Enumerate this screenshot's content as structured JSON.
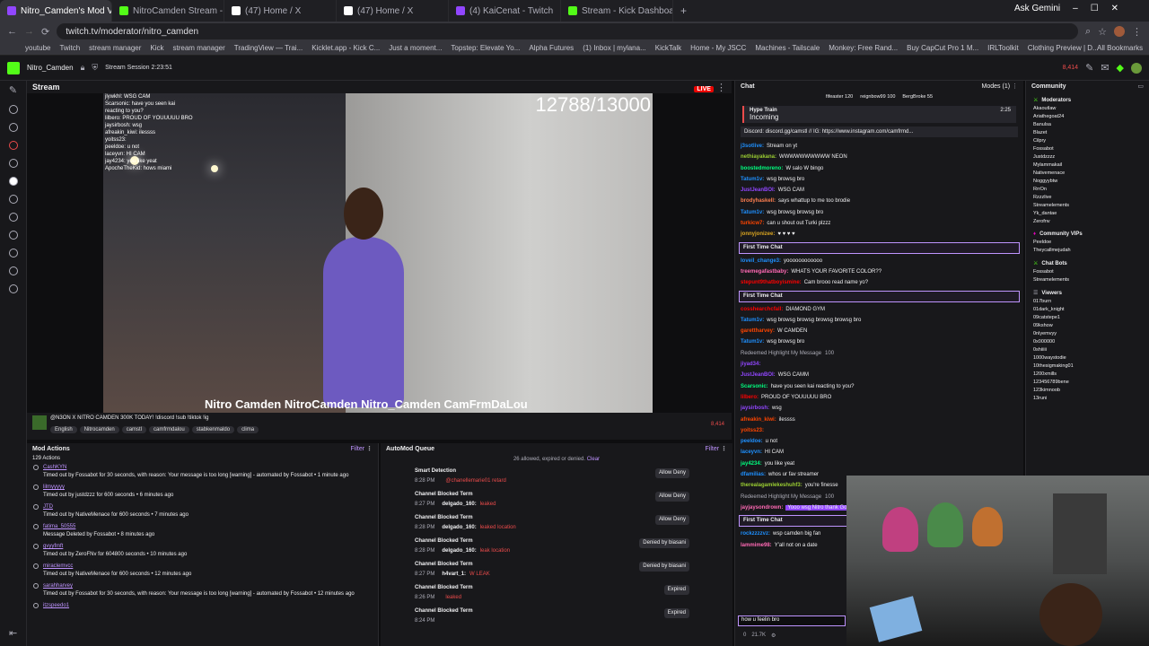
{
  "tabs": [
    {
      "label": "Nitro_Camden's Mod View",
      "active": true,
      "color": "#9146ff"
    },
    {
      "label": "NitroCamden Stream - Watch",
      "active": false,
      "color": "#53fc18"
    },
    {
      "label": "(47) Home / X",
      "active": false,
      "color": "#ffffff"
    },
    {
      "label": "(47) Home / X",
      "active": false,
      "color": "#ffffff"
    },
    {
      "label": "(4) KaiCenat - Twitch",
      "active": false,
      "color": "#9146ff"
    },
    {
      "label": "Stream - Kick Dashboard",
      "active": false,
      "color": "#53fc18"
    }
  ],
  "browser": {
    "ask_gemini": "Ask Gemini",
    "url": "twitch.tv/moderator/nitro_camden",
    "all_bookmarks": "All Bookmarks"
  },
  "bookmarks": [
    "youtube",
    "Twitch",
    "stream manager",
    "Kick",
    "stream manager",
    "TradingView — Trai...",
    "Kicklet.app - Kick C...",
    "Just a moment...",
    "Topstep: Elevate Yo...",
    "Alpha Futures",
    "(1) Inbox | mylana...",
    "KickTalk",
    "Home - My JSCC",
    "Machines - Tailscale",
    "Monkey: Free Rand...",
    "Buy CapCut Pro 1 M...",
    "IRLToolkit",
    "Clothing Preview | D..."
  ],
  "topnav": {
    "channel": "Nitro_Camden",
    "session": "Stream Session 2:23:51",
    "viewers": "8,414"
  },
  "stream": {
    "header": "Stream",
    "live": "LIVE",
    "counter": "12788/13000",
    "socials": "Nitro Camden  NitroCamden  Nitro_Camden  CamFrmDaLou",
    "overlay_chat": [
      "jlywkhl: WSG CAM",
      "Scarsonic: have you seen kai",
      "reacting to you?",
      "lilbero: PROUD OF YOUUUUU BRO",
      "jaysirbosh: wsg",
      "afreakin_kiwi: ilessss",
      "yoitss23:",
      "peeldoe: u not",
      "laceyvn: HI CAM",
      "jay4234: you like yeat",
      "ApocheTheKid: hows miami"
    ]
  },
  "stream_info": {
    "title": "@N3ON X NITRO CAMDEN 300K TODAY! !discord !sub !tiktok !ig",
    "viewers": "8,414",
    "tags": [
      "English",
      "Nitrocamden",
      "camstl",
      "camfrmdalou",
      "stabkenmaldo",
      "clima"
    ]
  },
  "mod_actions": {
    "title": "Mod Actions",
    "filter": "Filter",
    "count": "129 Actions",
    "items": [
      {
        "user": "CashKYN",
        "text": "Timed out by Fossabot for 30 seconds, with reason: Your message is too long [warning] - automated by Fossabot • 1 minute ago"
      },
      {
        "user": "lilmyyyyy",
        "text": "Timed out by justdzzz for 600 seconds • 6 minutes ago"
      },
      {
        "user": "JTD",
        "text": "Timed out by NativeMenace for 600 seconds • 7 minutes ago"
      },
      {
        "user": "fatima_50555",
        "text": "Message Deleted by Fossabot • 8 minutes ago"
      },
      {
        "user": "gvyyfmft",
        "text": "Timed out by ZeroFNv for 604800 seconds • 10 minutes ago"
      },
      {
        "user": "miraclemvcc",
        "text": "Timed out by NativeMenace for 600 seconds • 12 minutes ago"
      },
      {
        "user": "sarahharvey",
        "text": "Timed out by Fossabot for 30 seconds, with reason: Your message is too long [warning] - automated by Fossabot • 12 minutes ago"
      },
      {
        "user": "itzspeedo1",
        "text": ""
      }
    ]
  },
  "automod": {
    "title": "AutoMod Queue",
    "filter": "Filter",
    "summary": "26 allowed, expired or denied.",
    "clear": "Clear",
    "items": [
      {
        "type": "Smart Detection",
        "time": "8:28 PM",
        "user": "",
        "msg": "@chanellemarie01 retard",
        "state": "Allow  Deny"
      },
      {
        "type": "Channel Blocked Term",
        "time": "8:27 PM",
        "user": "delgado_160:",
        "msg": "leaked",
        "state": "Allow  Deny"
      },
      {
        "type": "Channel Blocked Term",
        "time": "8:28 PM",
        "user": "delgado_160:",
        "msg": "leaked location",
        "state": "Allow  Deny"
      },
      {
        "type": "Channel Blocked Term",
        "time": "8:28 PM",
        "user": "delgado_160:",
        "msg": "leak location",
        "state": "Denied by biasani"
      },
      {
        "type": "Channel Blocked Term",
        "time": "8:27 PM",
        "user": "h4vart_1:",
        "msg": "W LEAK",
        "state": "Denied by biasani"
      },
      {
        "type": "Channel Blocked Term",
        "time": "8:26 PM",
        "user": "",
        "msg": "leaked",
        "state": "Expired"
      },
      {
        "type": "Channel Blocked Term",
        "time": "8:24 PM",
        "user": "",
        "msg": "",
        "state": "Expired"
      }
    ]
  },
  "chat": {
    "title": "Chat",
    "modes": "Modes (1)",
    "gifters": [
      "fifeaster 120",
      "reignbow99 100",
      "BergBroke 55"
    ],
    "hype_title": "Hype Train",
    "hype_status": "Incoming",
    "hype_time": "2:25",
    "pinned": "Discord: discord.gg/camstl // IG: https://www.instagram.com/camfrmd...",
    "first_time": "First Time Chat",
    "redeemed": "Redeemed Highlight My Message",
    "redeem_cost": "100",
    "messages": [
      {
        "name": "j3sotlive:",
        "text": "Stream on yt",
        "color": "#1e90ff"
      },
      {
        "name": "nethiayakana:",
        "text": "WWWWWWWWWW NEON",
        "color": "#9acd32"
      },
      {
        "name": "boostedmoreno:",
        "text": "W salo W bingo",
        "color": "#00ff7f"
      },
      {
        "name": "Tatum1v:",
        "text": "wsg browsg bro",
        "color": "#1e90ff"
      },
      {
        "name": "JustJeanBOI:",
        "text": "WSG CAM",
        "color": "#9146ff"
      },
      {
        "name": "brodyhaskell:",
        "text": "says whattup to me too brodie",
        "color": "#ff7f50"
      },
      {
        "name": "Tatum1v:",
        "text": "wsg browsg browsg bro",
        "color": "#1e90ff"
      },
      {
        "name": "turkicw7:",
        "text": "can u shout out Turki plzzz",
        "color": "#ff4500"
      },
      {
        "name": "jonnyjonizee:",
        "text": "♥ ♥ ♥ ♥",
        "color": "#daa520"
      },
      {
        "name": "loveil_change3:",
        "text": "yoooooooooooo",
        "color": "#1e90ff"
      },
      {
        "name": "treemegafastbaby:",
        "text": "WHATS YOUR FAVORITE COLOR??",
        "color": "#ff69b4"
      },
      {
        "name": "stepunt9thatboyismine:",
        "text": "Cam brooo read name yo?",
        "color": "#ff0000"
      },
      {
        "name": "cosshearchcfall:",
        "text": "DIAMOND GYM",
        "color": "#ff0000"
      },
      {
        "name": "Tatum1v:",
        "text": "wsg browsg browsg browsg browsg bro",
        "color": "#1e90ff"
      },
      {
        "name": "garettharvey:",
        "text": "W CAMDEN",
        "color": "#ff4500"
      },
      {
        "name": "Tatum1v:",
        "text": "wsg browsg bro",
        "color": "#1e90ff"
      },
      {
        "name": "jiyad34:",
        "text": "",
        "color": "#9146ff"
      },
      {
        "name": "JustJeanBOI:",
        "text": "WSG CAMM",
        "color": "#9146ff"
      },
      {
        "name": "Scarsonic:",
        "text": "have you seen kai reacting to you?",
        "color": "#00ff7f"
      },
      {
        "name": "lilbero:",
        "text": "PROUD OF YOUUUUU BRO",
        "color": "#ff0000"
      },
      {
        "name": "jaysirbosh:",
        "text": "wsg",
        "color": "#9146ff"
      },
      {
        "name": "afreakin_kiwi:",
        "text": "ilessss",
        "color": "#ff4500"
      },
      {
        "name": "yoitss23:",
        "text": "",
        "color": "#ff4500"
      },
      {
        "name": "peeldoe:",
        "text": "u not",
        "color": "#1e90ff"
      },
      {
        "name": "laceyvn:",
        "text": "HI CAM",
        "color": "#1e90ff"
      },
      {
        "name": "jay4234:",
        "text": "you like yeat",
        "color": "#00ff7f"
      },
      {
        "name": "dfamilias:",
        "text": "whos ur fav streamer",
        "color": "#1e90ff"
      },
      {
        "name": "therealagamlekeshuhf3:",
        "text": "you're finesse",
        "color": "#9acd32"
      },
      {
        "name": "jayjaysondrown:",
        "text": "Yooo wsg Nitro thank God",
        "color": "#ff69b4"
      },
      {
        "name": "rockzzzzvz:",
        "text": "wsp camden big fan",
        "color": "#1e90ff"
      },
      {
        "name": "lammime98:",
        "text": "Y'all not on a date",
        "color": "#ff69b4"
      }
    ],
    "input": "how u feelin bro",
    "points": "21.7K",
    "zero": "0"
  },
  "community": {
    "title": "Community",
    "moderators_label": "Moderators",
    "moderators": [
      "Akaoutlaw",
      "Ariathegoat24",
      "Banulsa",
      "Blazet",
      "Cilpry",
      "Fossabot",
      "Justdzzzz",
      "Mylammakail",
      "Nativemenace",
      "Noggyybtw",
      "RrrOn",
      "Rzzzlive",
      "Streamelements",
      "Yk_dantae",
      "Zerofnv"
    ],
    "vips_label": "Community VIPs",
    "vips": [
      "Peeldoe",
      "Theycallmejudah"
    ],
    "bots_label": "Chat Bots",
    "bots": [
      "Fossabot",
      "Streamelements"
    ],
    "viewers_label": "Viewers",
    "viewers": [
      "017burn",
      "01dark_knight",
      "09catstepe1",
      "09kshow",
      "0nlyemvyy",
      "0x000000",
      "0shiiiii",
      "1000waystodie",
      "10thesigmaking01",
      "1200xmills",
      "123456789bene",
      "123kimnoob",
      "13runi"
    ]
  }
}
